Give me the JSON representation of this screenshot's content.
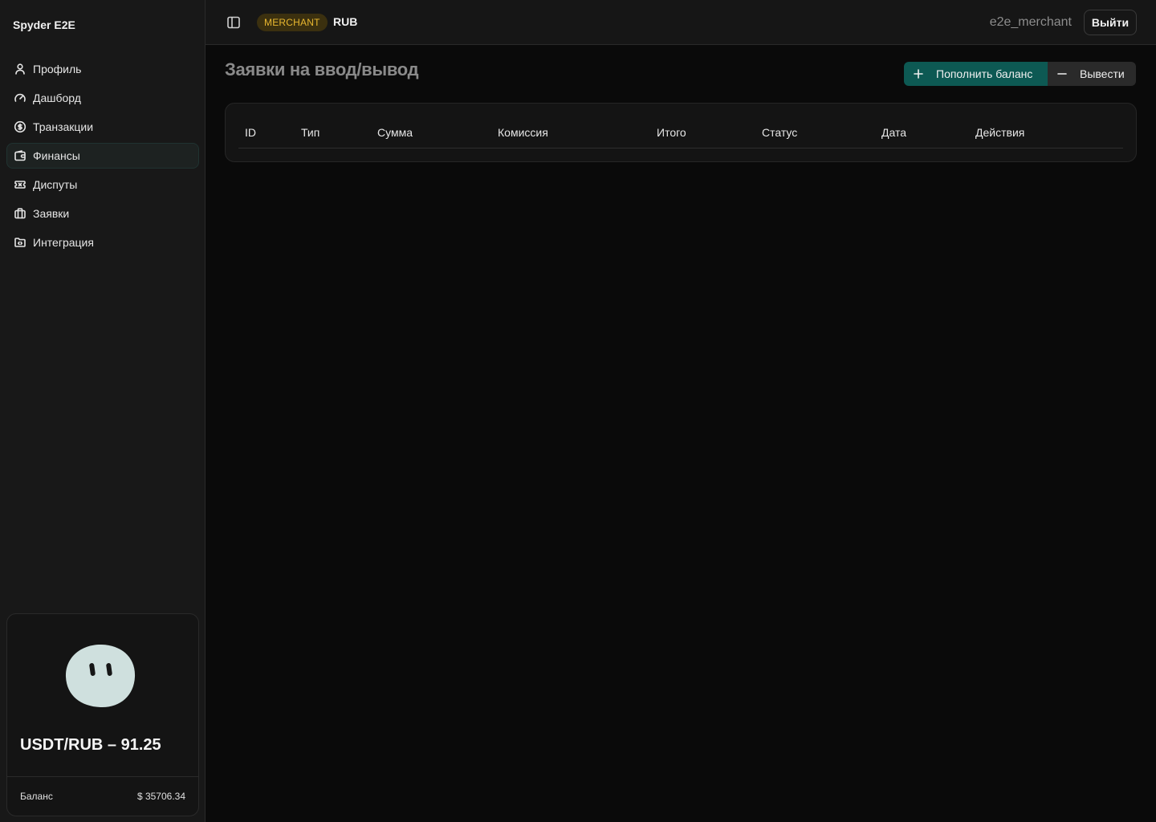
{
  "sidebar": {
    "brand": "Spyder E2E",
    "items": [
      {
        "label": "Профиль",
        "icon": "user-icon"
      },
      {
        "label": "Дашборд",
        "icon": "gauge-icon"
      },
      {
        "label": "Транзакции",
        "icon": "dollar-circle-icon"
      },
      {
        "label": "Финансы",
        "icon": "wallet-icon",
        "active": true
      },
      {
        "label": "Диспуты",
        "icon": "ticket-x-icon"
      },
      {
        "label": "Заявки",
        "icon": "briefcase-icon"
      },
      {
        "label": "Интеграция",
        "icon": "folder-code-icon"
      }
    ],
    "rate_card": {
      "rate": "USDT/RUB – 91.25",
      "balance_label": "Баланс",
      "balance_value": "$ 35706.34"
    }
  },
  "header": {
    "role": "MERCHANT",
    "currency": "RUB",
    "username": "e2e_merchant",
    "logout_label": "Выйти"
  },
  "main": {
    "title": "Заявки на ввод/вывод",
    "topup_label": "Пополнить баланс",
    "withdraw_label": "Вывести",
    "columns": [
      "ID",
      "Тип",
      "Сумма",
      "Комиссия",
      "Итого",
      "Статус",
      "Дата",
      "Действия"
    ]
  },
  "colors": {
    "accent": "#0d5953",
    "badge_bg": "#3b300f",
    "badge_text": "#e8b730",
    "mascot": "#cfe0de"
  }
}
